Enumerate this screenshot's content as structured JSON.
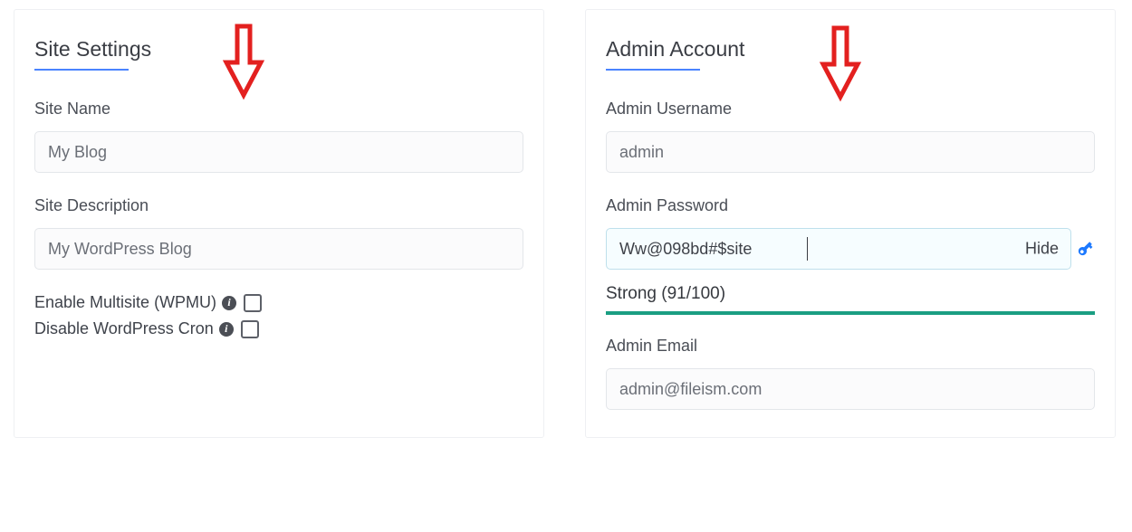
{
  "siteSettings": {
    "title": "Site Settings",
    "siteName": {
      "label": "Site Name",
      "value": "My Blog"
    },
    "siteDesc": {
      "label": "Site Description",
      "value": "My WordPress Blog"
    },
    "multisite": {
      "label": "Enable Multisite (WPMU)"
    },
    "cron": {
      "label": "Disable WordPress Cron"
    }
  },
  "adminAccount": {
    "title": "Admin Account",
    "username": {
      "label": "Admin Username",
      "value": "admin"
    },
    "password": {
      "label": "Admin Password",
      "value": "Ww@098bd#$site",
      "toggle": "Hide"
    },
    "strength": {
      "text": "Strong (91/100)"
    },
    "email": {
      "label": "Admin Email",
      "value": "admin@fileism.com"
    }
  }
}
